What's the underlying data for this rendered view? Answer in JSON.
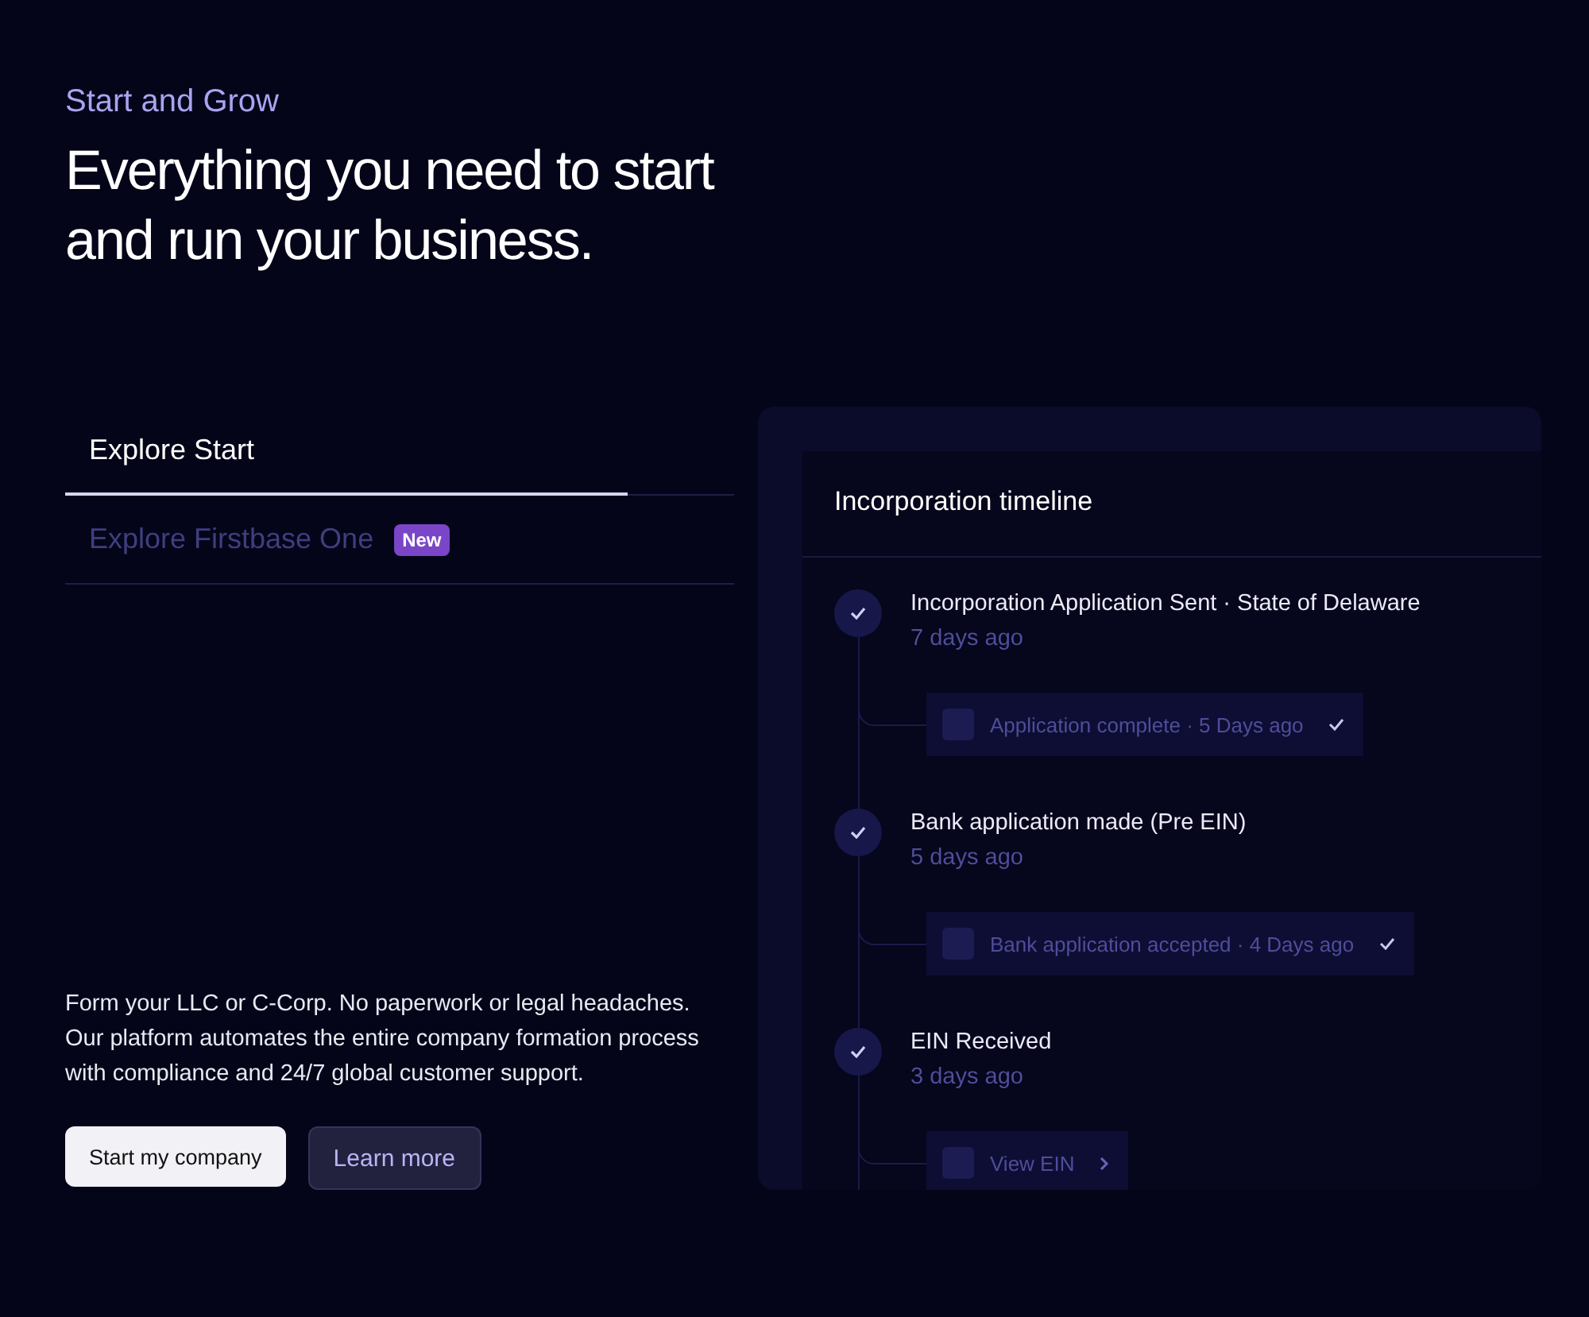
{
  "eyebrow": "Start and Grow",
  "headline": "Everything you need to start and run your business.",
  "tabs": [
    {
      "label": "Explore Start",
      "selected": true,
      "level": 0.84
    },
    {
      "label": "Explore Firstbase One",
      "selected": false,
      "badge": "New"
    }
  ],
  "description": "Form your LLC or C-Corp. No paperwork or legal headaches. Our platform automates the entire company formation process with compliance and 24/7 global customer support.",
  "buttons": [
    {
      "label": "Start my company",
      "kind": "primary"
    },
    {
      "label": "Learn more",
      "kind": "secondary"
    }
  ],
  "timeline": {
    "title": "Incorporation timeline",
    "events": [
      {
        "title": "Incorporation Application Sent · State of Delaware",
        "time": "7 days ago",
        "done": true,
        "sub": {
          "label": "Application complete · 5 Days ago",
          "kind": "check"
        }
      },
      {
        "title": "Bank application made (Pre EIN)",
        "time": "5 days ago",
        "done": true,
        "sub": {
          "label": "Bank application accepted · 4 Days ago",
          "kind": "check"
        }
      },
      {
        "title": "EIN Received",
        "time": "3 days ago",
        "done": true,
        "sub": {
          "label": "View EIN",
          "kind": "link"
        }
      }
    ]
  }
}
